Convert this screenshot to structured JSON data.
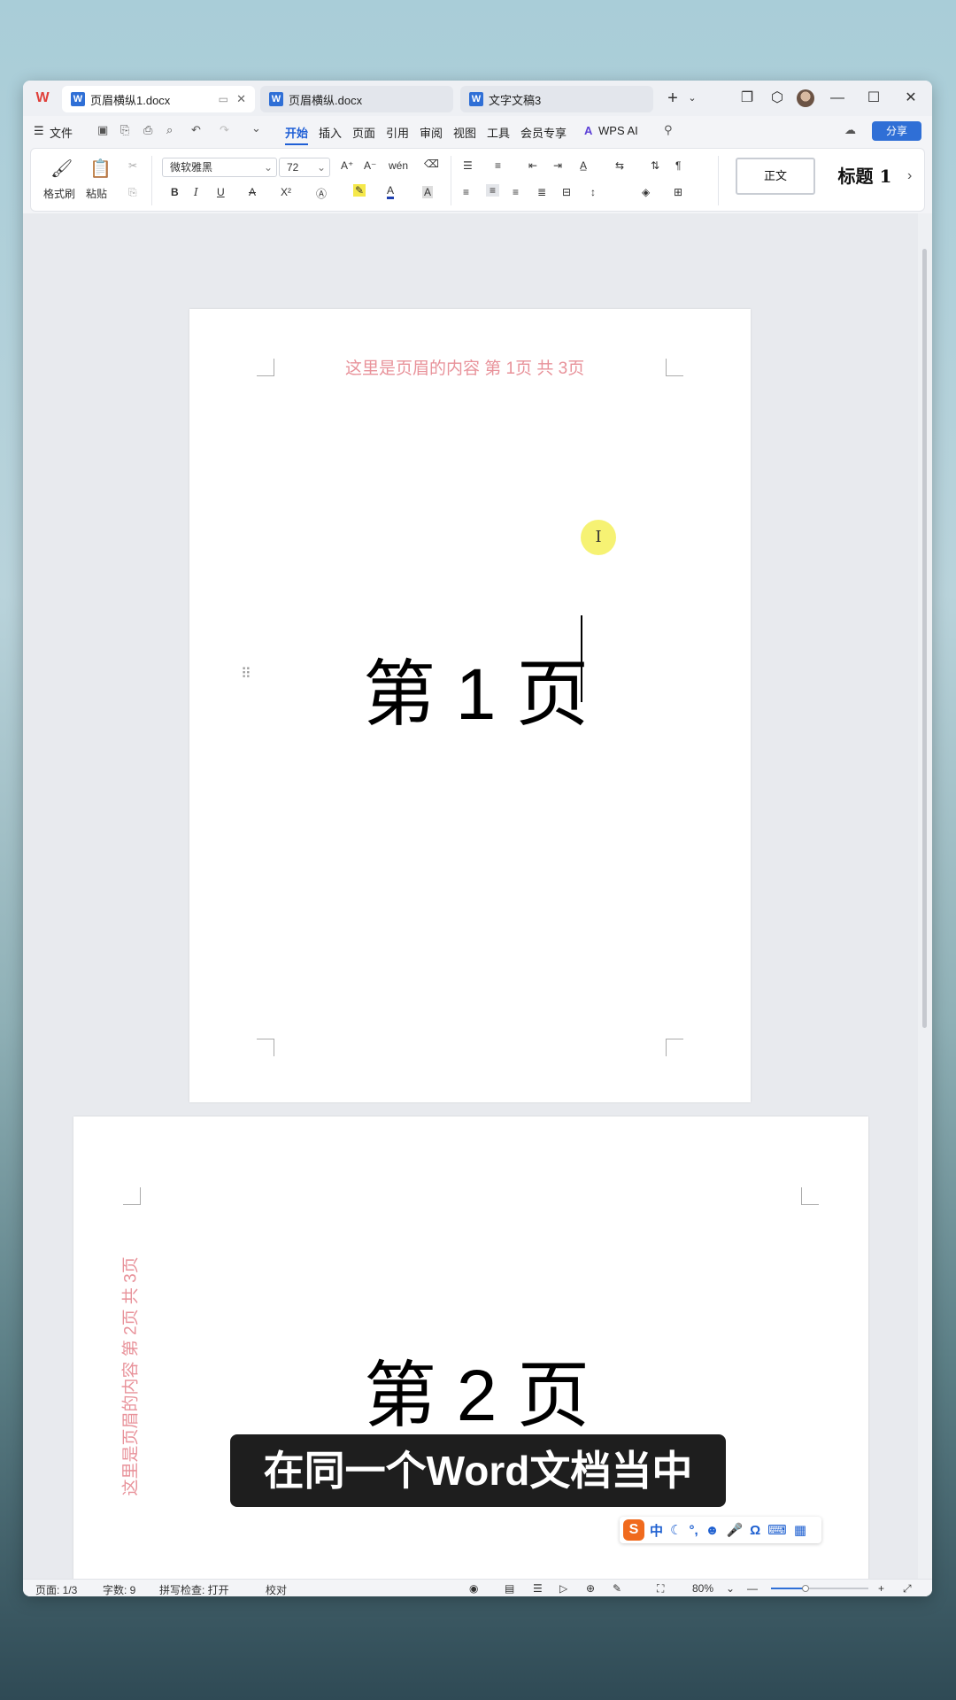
{
  "titlebar": {
    "tabs": [
      {
        "label": "页眉横纵1.docx",
        "active": true
      },
      {
        "label": "页眉横纵.docx",
        "active": false
      },
      {
        "label": "文字文稿3",
        "active": false
      }
    ],
    "new_tab": "+"
  },
  "menubar": {
    "file": "文件",
    "items": [
      "开始",
      "插入",
      "页面",
      "引用",
      "审阅",
      "视图",
      "工具",
      "会员专享"
    ],
    "selected": "开始",
    "wps_ai": "WPS AI",
    "share": "分享"
  },
  "ribbon": {
    "format_painter": "格式刷",
    "paste": "粘贴",
    "font_name": "微软雅黑",
    "font_size": "72",
    "style_normal": "正文",
    "style_heading1": "标题 1"
  },
  "document": {
    "page1": {
      "header": "这里是页眉的内容  第 1页  共 3页",
      "body": "第 1 页"
    },
    "page2": {
      "header_vertical": "这里是页眉的内容  第 2页  共 3页",
      "body": "第 2 页"
    },
    "cursor_icon": "I"
  },
  "statusbar": {
    "page": "页面: 1/3",
    "words": "字数: 9",
    "spellcheck": "拼写检查: 打开",
    "proofread": "校对",
    "zoom": "80%",
    "zoom_fraction": 0.35
  },
  "caption": "在同一个Word文档当中",
  "ime": {
    "logo": "S",
    "mode": "中"
  },
  "colors": {
    "accent": "#2f6fd6",
    "header_text": "#e8929a"
  }
}
